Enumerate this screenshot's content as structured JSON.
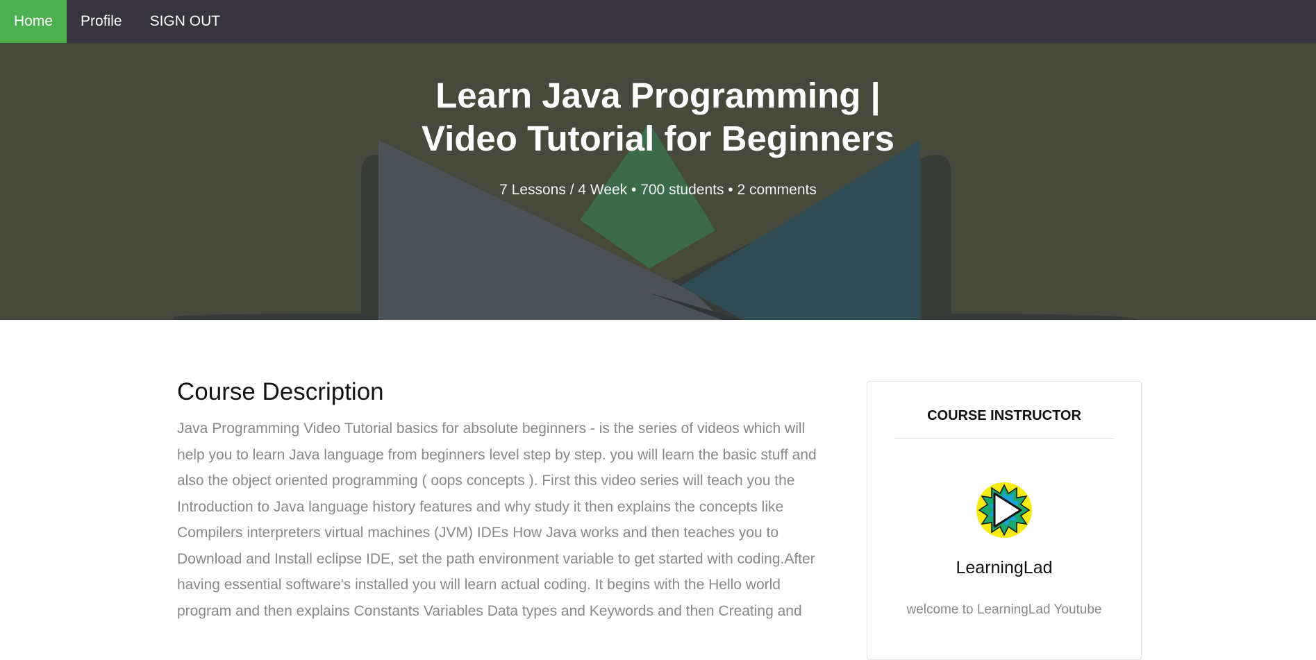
{
  "nav": {
    "items": [
      {
        "label": "Home",
        "active": true
      },
      {
        "label": "Profile",
        "active": false
      },
      {
        "label": "SIGN OUT",
        "active": false
      }
    ]
  },
  "hero": {
    "title_line1": "Learn Java Programming |",
    "title_line2": "Video Tutorial for Beginners",
    "meta": "7 Lessons / 4 Week • 700 students • 2 comments"
  },
  "description": {
    "heading": "Course Description",
    "text": "Java Programming Video Tutorial basics for absolute beginners - is the series of videos which will help you to learn Java language from beginners level step by step. you will learn the basic stuff and also the object oriented programming ( oops concepts ). First this video series will teach you the Introduction to Java language history features and why study it then explains the concepts like Compilers interpreters virtual machines (JVM) IDEs How Java works and then teaches you to Download and Install eclipse IDE, set the path environment variable to get started with coding.After having essential software's installed you will learn actual coding. It begins with the Hello world program and then explains Constants Variables Data types and Keywords and then Creating and"
  },
  "instructor": {
    "heading": "COURSE INSTRUCTOR",
    "name": "LearningLad",
    "bio": "welcome to LearningLad Youtube",
    "avatar_icon": "play-logo-icon"
  },
  "colors": {
    "nav_bg": "#37333f",
    "nav_active": "#4caf50",
    "hero_bg": "#47493a"
  }
}
